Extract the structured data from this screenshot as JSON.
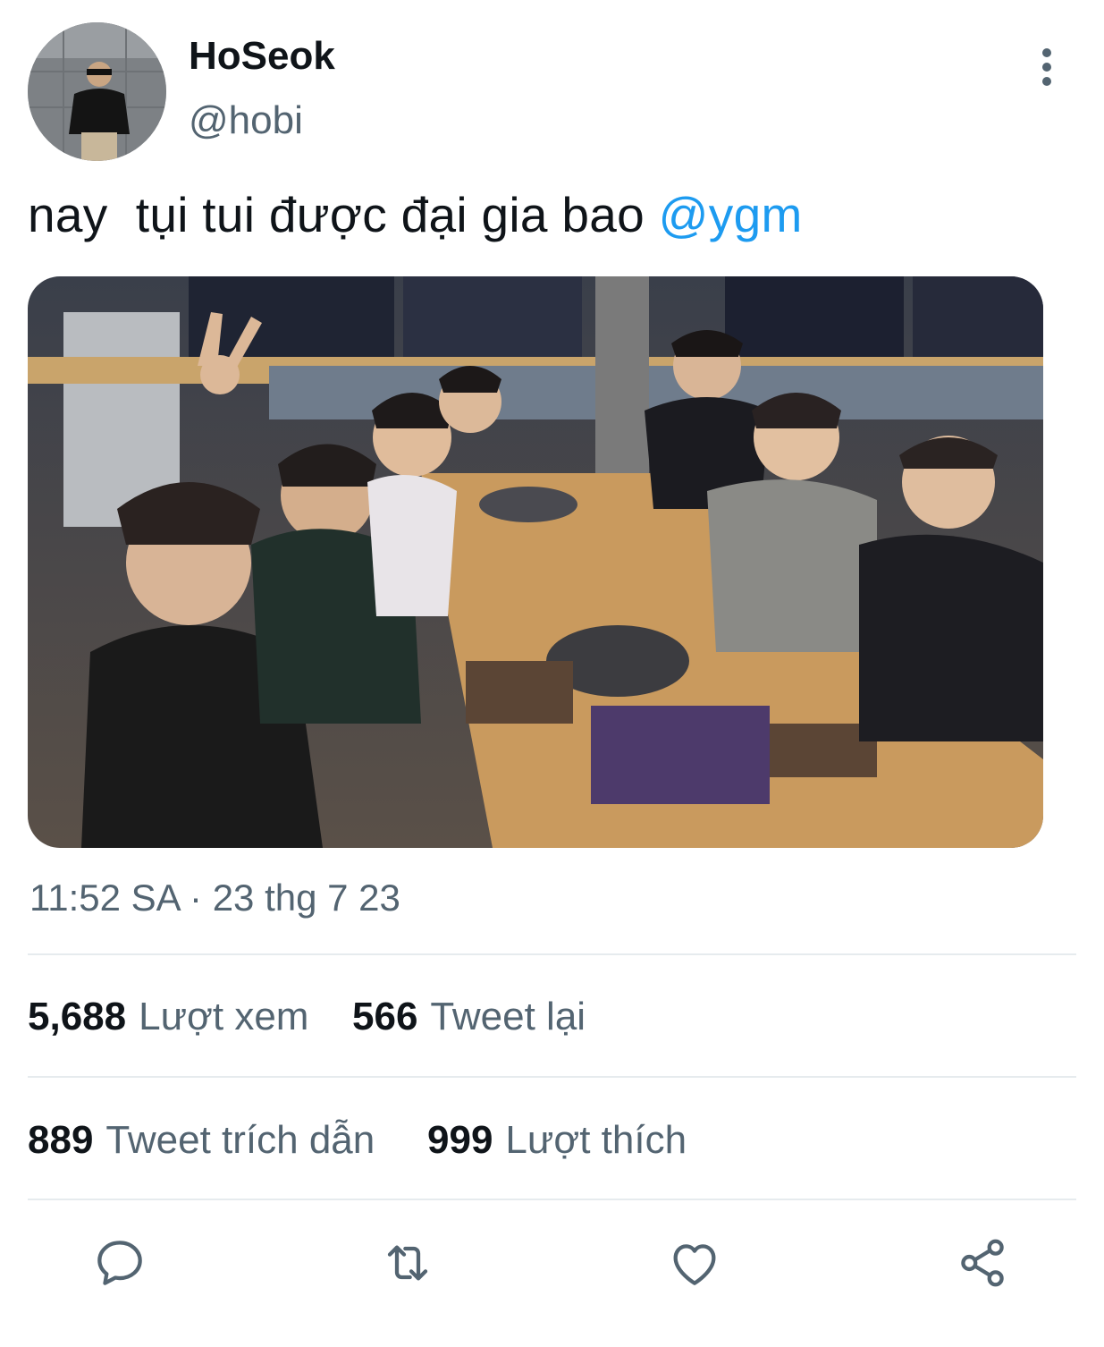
{
  "tweet": {
    "display_name": "HoSeok",
    "handle": "@hobi",
    "text_main": "nay  tụi tui được đại gia bao ",
    "text_mention": "@ygm",
    "timestamp": "11:52 SA · 23 thg 7 23"
  },
  "stats": {
    "views_count": "5,688",
    "views_label": "Lượt xem",
    "retweets_count": "566",
    "retweets_label": "Tweet lại",
    "quotes_count": "889",
    "quotes_label": "Tweet trích dẫn",
    "likes_count": "999",
    "likes_label": "Lượt thích"
  },
  "icons": {
    "more": "more-vertical-icon",
    "reply": "reply-icon",
    "retweet": "retweet-icon",
    "like": "heart-icon",
    "share": "share-icon"
  },
  "colors": {
    "text": "#0f1419",
    "secondary": "#536471",
    "accent": "#1d9bf0",
    "divider": "#e6ebee"
  }
}
